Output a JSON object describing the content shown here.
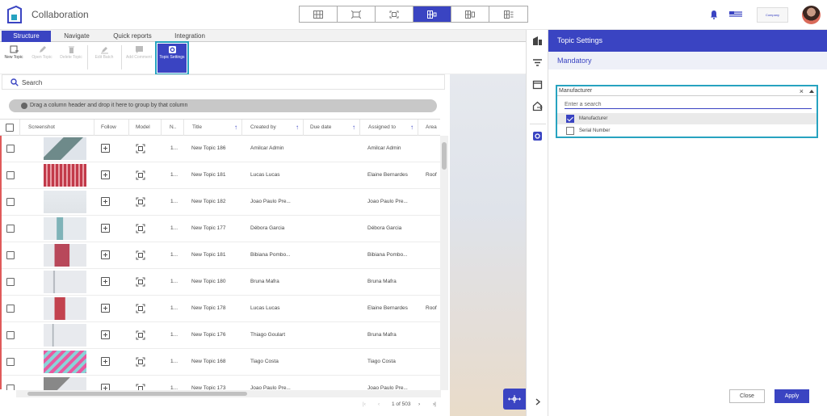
{
  "app": {
    "title": "Collaboration"
  },
  "company_logo_text": "Company",
  "tabs": [
    "Structure",
    "Navigate",
    "Quick reports",
    "Integration"
  ],
  "ribbon": [
    {
      "label": "New Topic",
      "icon": "new-topic-icon",
      "disabled": false
    },
    {
      "label": "Open Topic",
      "icon": "pencil-icon",
      "disabled": true
    },
    {
      "label": "Delete Topic",
      "icon": "trash-icon",
      "disabled": true
    },
    {
      "label": "Edit Batch",
      "icon": "edit-batch-icon",
      "disabled": true
    },
    {
      "label": "Add Comment",
      "icon": "comment-icon",
      "disabled": true
    },
    {
      "label": "Topic Settings",
      "icon": "settings-icon",
      "disabled": false,
      "active": true
    }
  ],
  "search": {
    "placeholder": "Search"
  },
  "groupbar": {
    "text": "Drag a column header and drop it here to group by that column"
  },
  "columns": [
    "Screenshot",
    "Follow",
    "Model",
    "N..",
    "Title",
    "Created by",
    "Due date",
    "Assigned to",
    "Area"
  ],
  "rows": [
    {
      "n": "1...",
      "title": "New Topic 186",
      "created_by": "Amilcar Admin",
      "due": "",
      "assigned": "Amilcar Admin",
      "area": ""
    },
    {
      "n": "1...",
      "title": "New Topic 181",
      "created_by": "Lucas Lucas",
      "due": "",
      "assigned": "Elaine Bernardes",
      "area": "Roof"
    },
    {
      "n": "1...",
      "title": "New Topic 182",
      "created_by": "Joao Paulo Pre...",
      "due": "",
      "assigned": "Joao Paulo Pre...",
      "area": ""
    },
    {
      "n": "1...",
      "title": "New Topic 177",
      "created_by": "Débora Garcia",
      "due": "",
      "assigned": "Débora Garcia",
      "area": ""
    },
    {
      "n": "1...",
      "title": "New Topic 181",
      "created_by": "Bibiana Pombo...",
      "due": "",
      "assigned": "Bibiana Pombo...",
      "area": ""
    },
    {
      "n": "1...",
      "title": "New Topic 180",
      "created_by": "Bruna Mafra",
      "due": "",
      "assigned": "Bruna Mafra",
      "area": ""
    },
    {
      "n": "1...",
      "title": "New Topic 178",
      "created_by": "Lucas Lucas",
      "due": "",
      "assigned": "Elaine Bernardes",
      "area": "Roof"
    },
    {
      "n": "1...",
      "title": "New Topic 176",
      "created_by": "Thiago Goulart",
      "due": "",
      "assigned": "Bruna Mafra",
      "area": ""
    },
    {
      "n": "1...",
      "title": "New Topic 168",
      "created_by": "Tiago Costa",
      "due": "",
      "assigned": "Tiago Costa",
      "area": ""
    },
    {
      "n": "1...",
      "title": "New Topic 173",
      "created_by": "Joao Paulo Pre...",
      "due": "",
      "assigned": "Joao Paulo Pre...",
      "area": ""
    }
  ],
  "pager": {
    "first": "|‹",
    "prev": "‹",
    "text": "1 of 503",
    "next": "›",
    "last": "›|"
  },
  "panel": {
    "title": "Topic Settings",
    "subtitle": "Mandatory",
    "select": {
      "value": "Manufacturer",
      "clear": "×",
      "search_placeholder": "Enter a search",
      "options": [
        {
          "label": "Manufacturer",
          "checked": true
        },
        {
          "label": "Serial Number",
          "checked": false
        }
      ]
    },
    "close_label": "Close",
    "apply_label": "Apply"
  },
  "colors": {
    "accent": "#3a44c2",
    "highlight": "#27a3c0",
    "row_marker": "#e05a5a"
  }
}
